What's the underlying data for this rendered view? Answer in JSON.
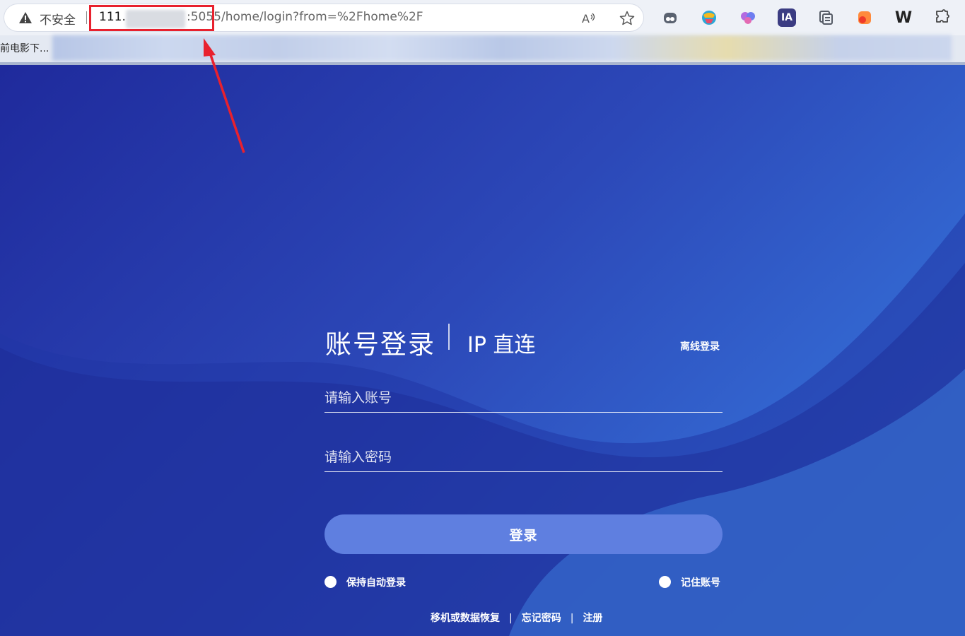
{
  "browser": {
    "security_label": "不安全",
    "url_host_prefix": "111.",
    "url_port_path": ":5055/home/login?from=%2Fhome%2F",
    "bookmark_label": "前电影下...",
    "icons": {
      "warning": "warning-triangle-icon",
      "read_aloud": "read-aloud-icon",
      "favorite": "star-icon"
    },
    "extensions": [
      {
        "name": "ghost-extension-icon",
        "color": "#5a6270"
      },
      {
        "name": "colorful-globe-extension-icon",
        "color": "#2aa7d8"
      },
      {
        "name": "brain-extension-icon",
        "color": "#b36be0"
      },
      {
        "name": "ia-extension-icon",
        "label": "IA",
        "color": "#3b3c82"
      },
      {
        "name": "collections-extension-icon",
        "color": "#555b66"
      },
      {
        "name": "orange-extension-icon",
        "color": "#ff6a2f"
      },
      {
        "name": "w-extension-icon",
        "label": "W",
        "color": "#222222"
      },
      {
        "name": "puzzle-extensions-icon",
        "color": "#444444"
      }
    ]
  },
  "login": {
    "tab_account": "账号登录",
    "tab_ip": "IP 直连",
    "offline_link": "离线登录",
    "account_placeholder": "请输入账号",
    "password_placeholder": "请输入密码",
    "submit_label": "登录",
    "keep_login_label": "保持自动登录",
    "remember_account_label": "记住账号",
    "footer_links": [
      "移机或数据恢复",
      "忘记密码",
      "注册"
    ],
    "footer_separator": "|"
  },
  "colors": {
    "annotation_red": "#e8212e",
    "button_blue": "#5f7fe0",
    "background_dark": "#1f2a9c",
    "background_light": "#3a80dc"
  }
}
